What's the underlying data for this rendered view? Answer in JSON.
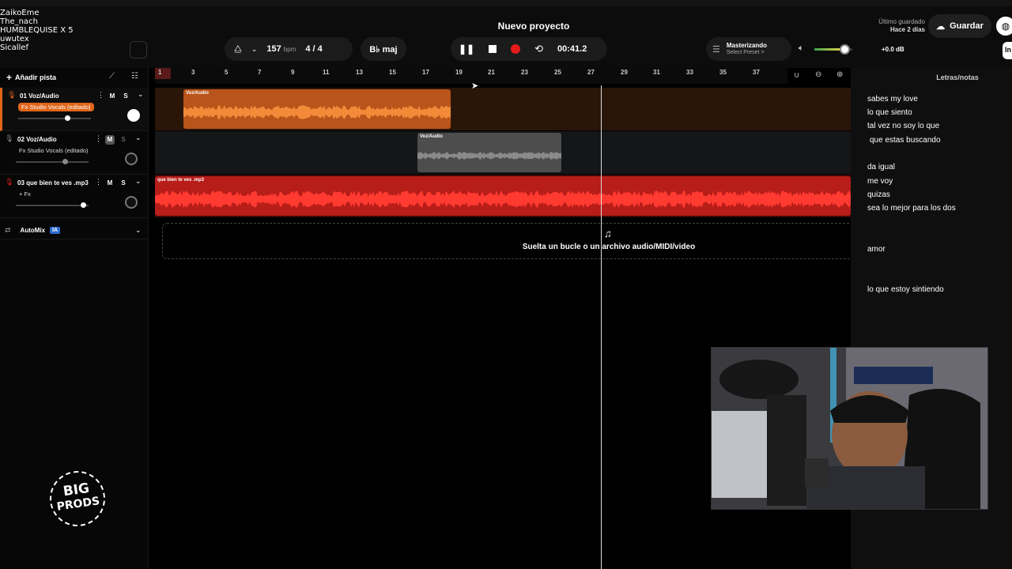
{
  "overlay_names": [
    "ZaikoEme",
    "The_nach",
    "HUMBLEQUISE X 5",
    "uwutex",
    "Sicallef"
  ],
  "header": {
    "project_title": "Nuevo proyecto",
    "bpm_value": "157",
    "bpm_unit": "bpm",
    "time_signature": "4 / 4",
    "key": "B♭ maj",
    "time_display": "00:41.2",
    "mastering_label": "Masterizando",
    "mastering_preset": "Select Preset >",
    "master_gain": "+0.0 dB",
    "saved_label": "Último guardado",
    "saved_when": "Hace 2 días",
    "save_label": "Guardar",
    "invite_label": "In"
  },
  "sidebar": {
    "add_track_label": "Añadir pista",
    "tracks": [
      {
        "name": "01  Voz/Audio",
        "fx": "Fx Studio Vocals (editado)",
        "mute": "M",
        "solo": "S"
      },
      {
        "name": "02  Voz/Audio",
        "fx": "Fx Studio Vocals (editado)",
        "mute": "M",
        "solo": "S"
      },
      {
        "name": "03  que bien te ves .mp3",
        "fx": "+ Fx",
        "mute": "M",
        "solo": "S"
      }
    ],
    "automix_label": "AutoMix",
    "automix_badge": "IA"
  },
  "ruler": {
    "ticks": [
      "1",
      "3",
      "5",
      "7",
      "9",
      "11",
      "13",
      "15",
      "17",
      "19",
      "21",
      "23",
      "25",
      "27",
      "29",
      "31",
      "33",
      "35",
      "37"
    ]
  },
  "clips": [
    {
      "label": "Voz/Audio"
    },
    {
      "label": "Voz/Audio"
    },
    {
      "label": "que bien te ves .mp3"
    }
  ],
  "drop_zone_text": "Suelta un bucle o un archivo audio/MIDI/video",
  "lyrics": {
    "title": "Letras/notas",
    "lines": [
      "sabes my love",
      "lo que siento",
      "tal vez no soy lo que",
      "que estas buscando",
      "da igual",
      "me voy",
      "quizas",
      "sea lo mejor para los dos",
      "amor",
      "lo que estoy sintiendo"
    ]
  },
  "logo": {
    "top": "BIG",
    "bottom": "PRODS"
  },
  "colors": {
    "accent_orange": "#e0651a",
    "track3_red": "#d9201c",
    "record": "#e51b1b",
    "clip_grey": "#5a5a5a"
  },
  "master_volume_level": 0.8
}
